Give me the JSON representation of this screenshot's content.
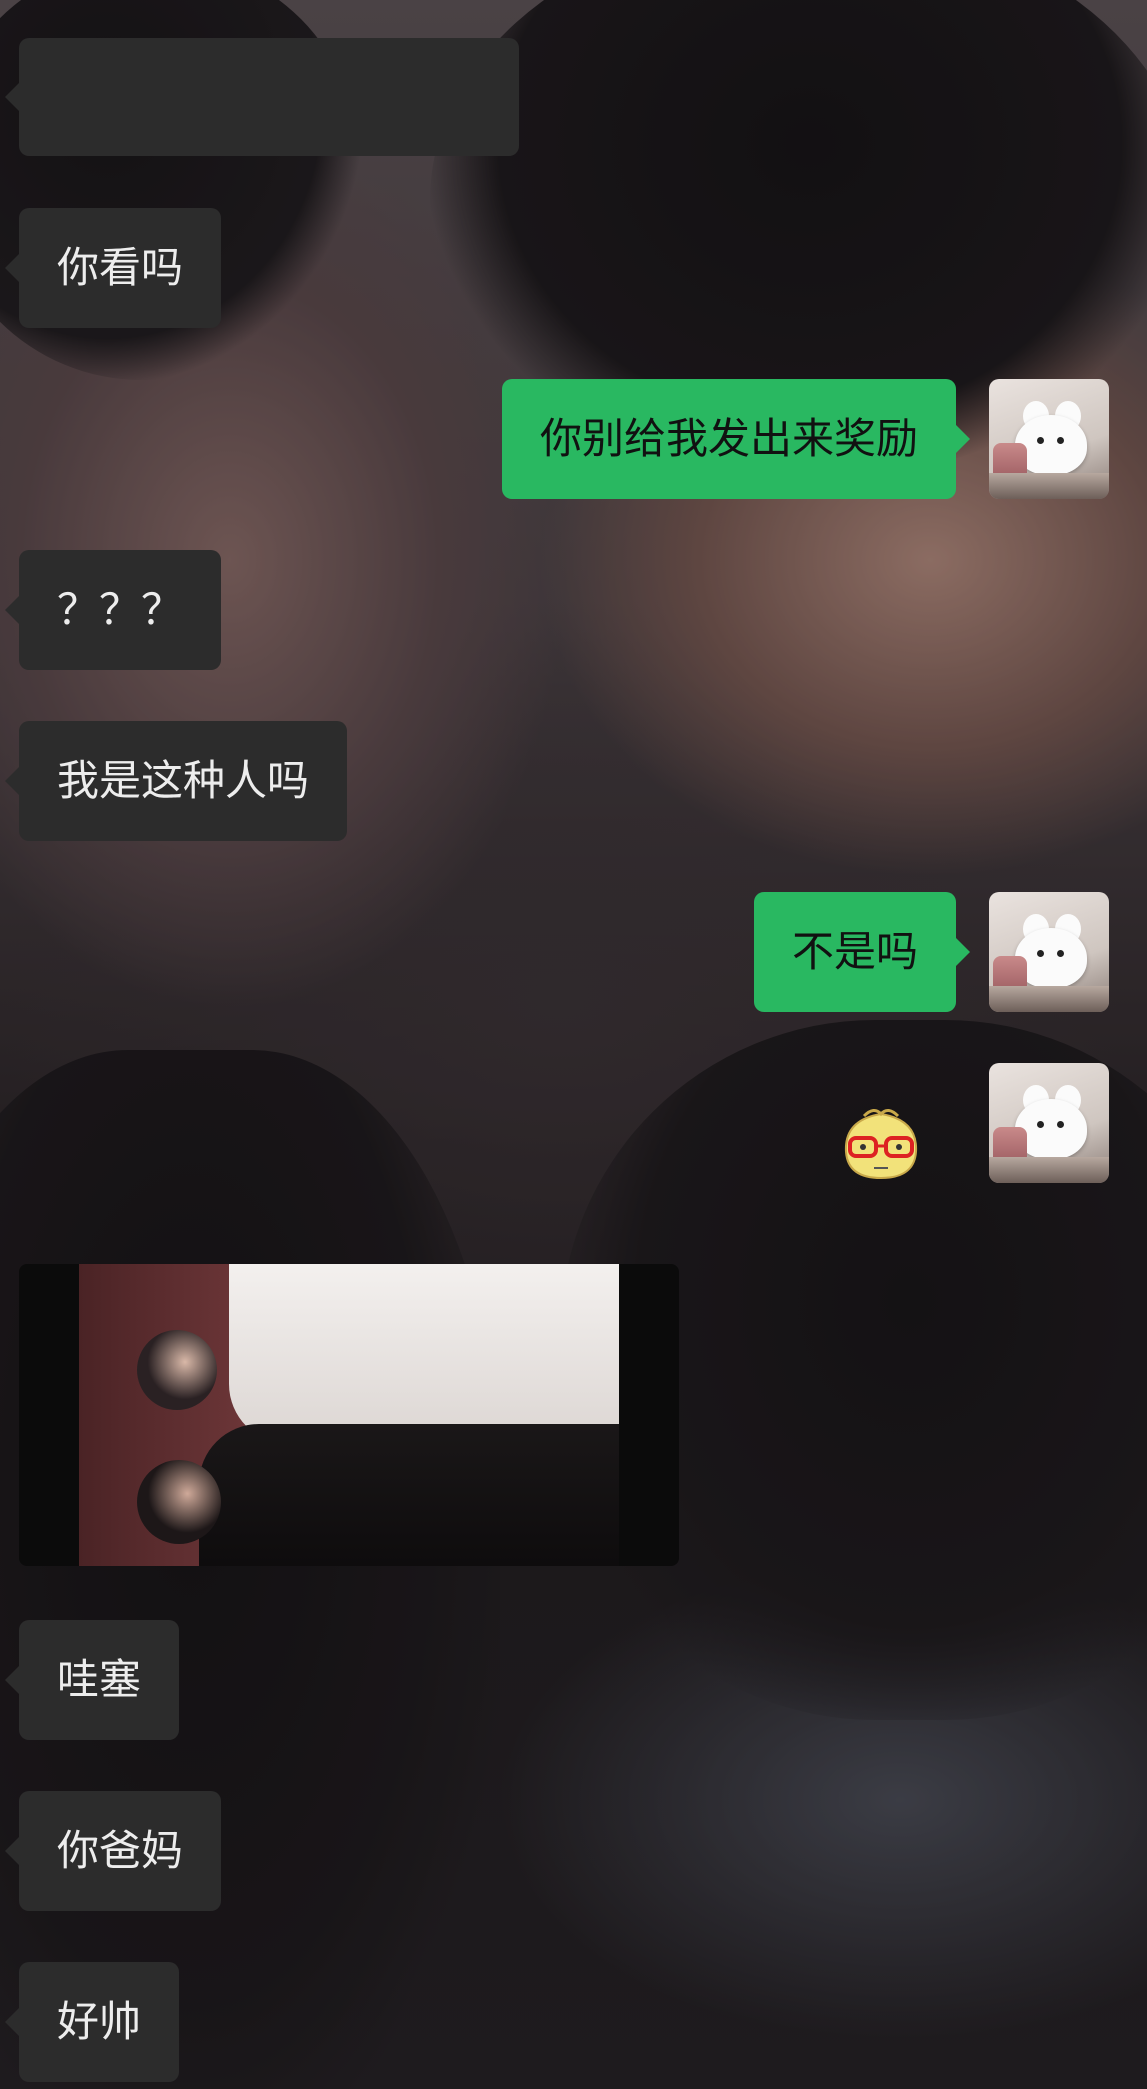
{
  "messages": {
    "m2": "你看吗",
    "m3": "你别给我发出来奖励",
    "m4": "？？？",
    "m5": "我是这种人吗",
    "m6": "不是吗",
    "m8": "哇塞",
    "m9": "你爸妈",
    "m10": "好帅"
  },
  "colors": {
    "incoming_bubble": "#2c2c2c",
    "outgoing_bubble": "#29b861",
    "incoming_text": "#ededed",
    "outgoing_text": "#111111"
  },
  "icons": {
    "avatar": "white-bunny-avatar",
    "sticker": "glasses-face-sticker"
  }
}
